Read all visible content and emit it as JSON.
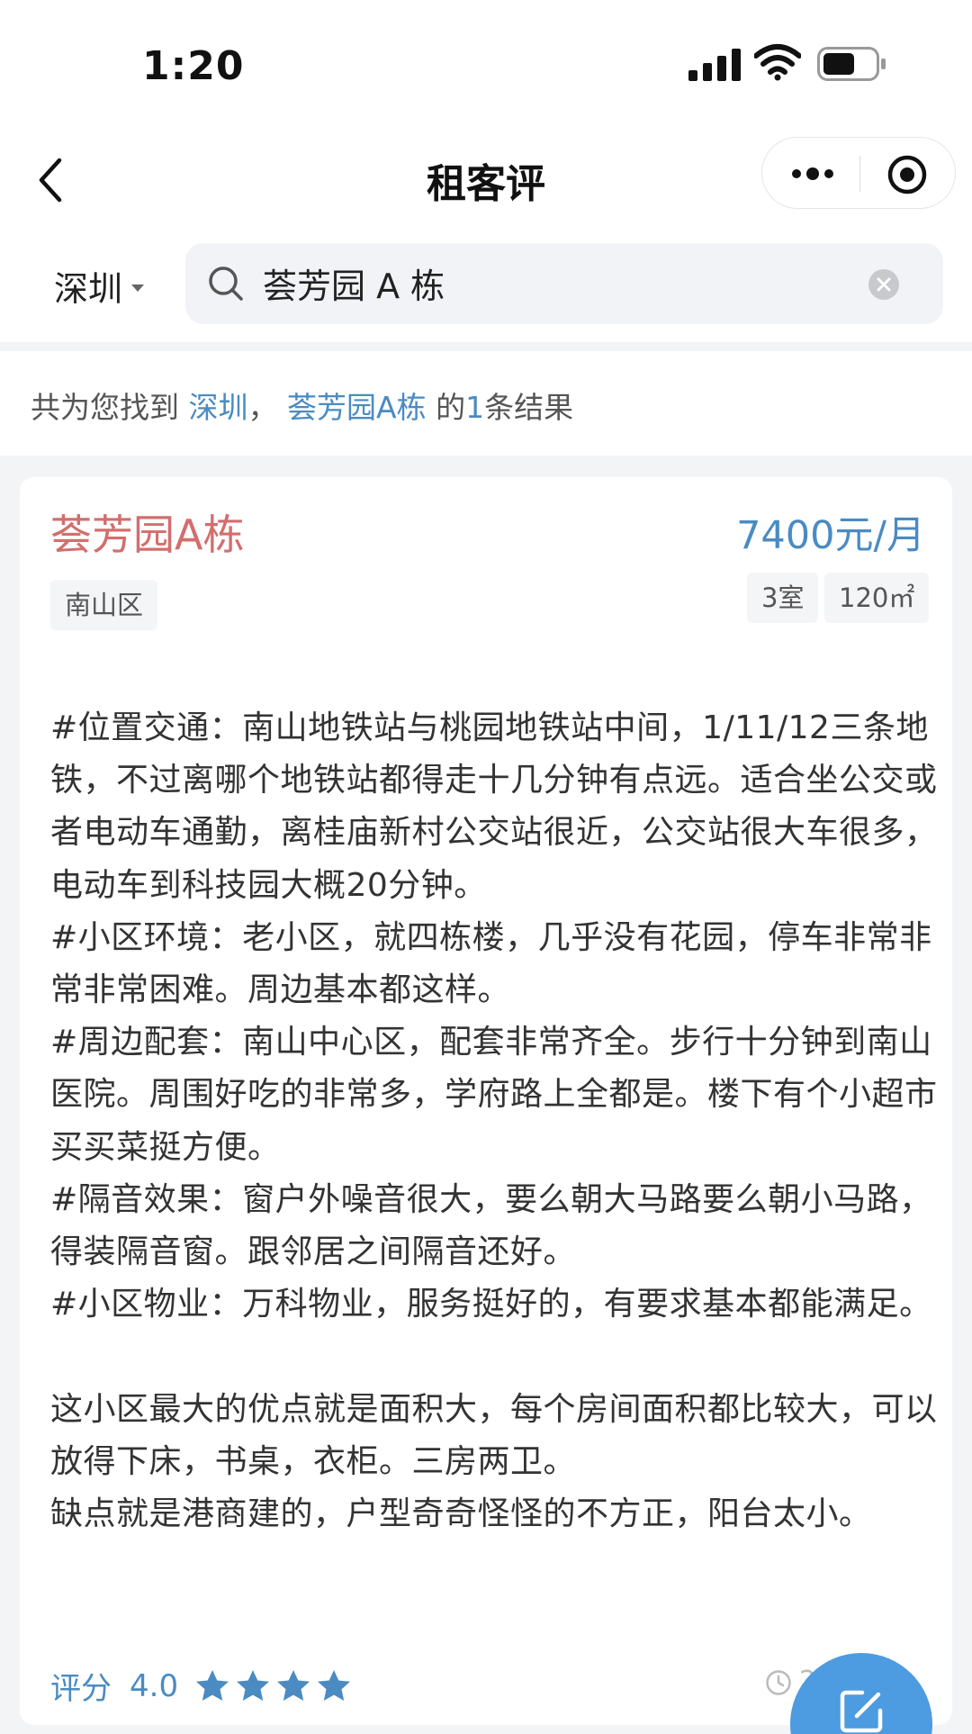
{
  "status_bar": {
    "time": "1:20"
  },
  "nav": {
    "title": "租客评"
  },
  "search": {
    "city": "深圳",
    "query": "荟芳园 A 栋"
  },
  "summary": {
    "prefix": "共为您找到 ",
    "city": "深圳",
    "sep": "， ",
    "keyword": "荟芳园A栋",
    "mid": " 的",
    "count": "1",
    "suffix": "条结果"
  },
  "card": {
    "title": "荟芳园A栋",
    "price": "7400元/月",
    "district": "南山区",
    "rooms": "3室",
    "area": "120㎡",
    "review": "#位置交通：南山地铁站与桃园地铁站中间，1/11/12三条地铁，不过离哪个地铁站都得走十几分钟有点远。适合坐公交或者电动车通勤，离桂庙新村公交站很近，公交站很大车很多，电动车到科技园大概20分钟。\n#小区环境：老小区，就四栋楼，几乎没有花园，停车非常非常非常困难。周边基本都这样。\n#周边配套：南山中心区，配套非常齐全。步行十分钟到南山医院。周围好吃的非常多，学府路上全都是。楼下有个小超市买买菜挺方便。\n#隔音效果：窗户外噪音很大，要么朝大马路要么朝小马路，得装隔音窗。跟邻居之间隔音还好。\n#小区物业：万科物业，服务挺好的，有要求基本都能满足。\n\n这小区最大的优点就是面积大，每个房间面积都比较大，可以放得下床，书桌，衣柜。三房两卫。\n缺点就是港商建的，户型奇奇怪怪的不方正，阳台太小。",
    "rating_label": "评分",
    "rating_value": "4.0",
    "stars": 4,
    "date": "2"
  },
  "colors": {
    "accent": "#4a8bc2",
    "title_red": "#d46d6d",
    "fab": "#4d9be0"
  },
  "icons": [
    "back-icon",
    "more-icon",
    "target-icon",
    "search-icon",
    "clear-icon",
    "star-icon",
    "clock-icon",
    "edit-icon"
  ]
}
